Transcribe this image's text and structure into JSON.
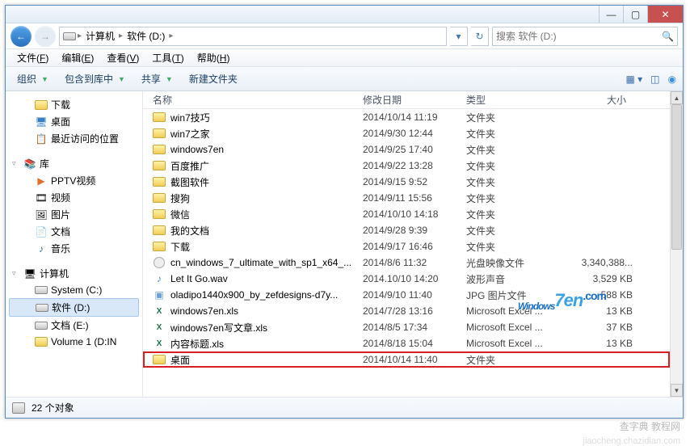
{
  "titlebar": {
    "min": "—",
    "max": "▢",
    "close": "✕"
  },
  "address": {
    "computer": "计算机",
    "drive": "软件 (D:)"
  },
  "search": {
    "placeholder": "搜索 软件 (D:)"
  },
  "menu": {
    "file": "文件",
    "file_k": "F",
    "edit": "编辑",
    "edit_k": "E",
    "view": "查看",
    "view_k": "V",
    "tools": "工具",
    "tools_k": "T",
    "help": "帮助",
    "help_k": "H"
  },
  "toolbar": {
    "organize": "组织",
    "include": "包含到库中",
    "share": "共享",
    "newfolder": "新建文件夹"
  },
  "nav": {
    "downloads": "下载",
    "desktop": "桌面",
    "recent": "最近访问的位置",
    "libraries": "库",
    "pptv": "PPTV视频",
    "videos": "视频",
    "pictures": "图片",
    "documents": "文档",
    "music": "音乐",
    "computer": "计算机",
    "systemc": "System (C:)",
    "softd": "软件 (D:)",
    "doce": "文档 (E:)",
    "vol1": "Volume 1 (D:IN"
  },
  "cols": {
    "name": "名称",
    "date": "修改日期",
    "type": "类型",
    "size": "大小"
  },
  "rows": [
    {
      "icon": "folder",
      "name": "win7技巧",
      "date": "2014/10/14 11:19",
      "type": "文件夹",
      "size": ""
    },
    {
      "icon": "folder",
      "name": "win7之家",
      "date": "2014/9/30 12:44",
      "type": "文件夹",
      "size": ""
    },
    {
      "icon": "folder",
      "name": "windows7en",
      "date": "2014/9/25 17:40",
      "type": "文件夹",
      "size": ""
    },
    {
      "icon": "folder",
      "name": "百度推广",
      "date": "2014/9/22 13:28",
      "type": "文件夹",
      "size": ""
    },
    {
      "icon": "folder",
      "name": "截图软件",
      "date": "2014/9/15 9:52",
      "type": "文件夹",
      "size": ""
    },
    {
      "icon": "folder",
      "name": "搜狗",
      "date": "2014/9/11 15:56",
      "type": "文件夹",
      "size": ""
    },
    {
      "icon": "folder",
      "name": "微信",
      "date": "2014/10/10 14:18",
      "type": "文件夹",
      "size": ""
    },
    {
      "icon": "folder",
      "name": "我的文档",
      "date": "2014/9/28 9:39",
      "type": "文件夹",
      "size": ""
    },
    {
      "icon": "folder",
      "name": "下载",
      "date": "2014/9/17 16:46",
      "type": "文件夹",
      "size": ""
    },
    {
      "icon": "iso",
      "name": "cn_windows_7_ultimate_with_sp1_x64_...",
      "date": "2014/8/6 11:32",
      "type": "光盘映像文件",
      "size": "3,340,388..."
    },
    {
      "icon": "wav",
      "name": "Let It Go.wav",
      "date": "2014.10/10 14:20",
      "type": "波形声音",
      "size": "3,529 KB"
    },
    {
      "icon": "jpg",
      "name": "oladipo1440x900_by_zefdesigns-d7y...",
      "date": "2014/9/10 11:40",
      "type": "JPG 图片文件",
      "size": "588 KB"
    },
    {
      "icon": "xls",
      "name": "windows7en.xls",
      "date": "2014/7/28 13:16",
      "type": "Microsoft Excel ...",
      "size": "13 KB"
    },
    {
      "icon": "xls",
      "name": "windows7en写文章.xls",
      "date": "2014/8/5 17:34",
      "type": "Microsoft Excel ...",
      "size": "37 KB"
    },
    {
      "icon": "xls",
      "name": "内容标题.xls",
      "date": "2014/8/18 15:04",
      "type": "Microsoft Excel ...",
      "size": "13 KB"
    },
    {
      "icon": "folder",
      "name": "桌面",
      "date": "2014/10/14 11:40",
      "type": "文件夹",
      "size": "",
      "hl": true
    }
  ],
  "status": {
    "count": "22 个对象"
  },
  "watermark": {
    "p1": "Windows",
    "p2": "7",
    "p3": "en",
    "tail": ".com"
  },
  "footer": {
    "t1": "查字典  教程网",
    "t2": "jiaocheng.chazidian.com"
  }
}
